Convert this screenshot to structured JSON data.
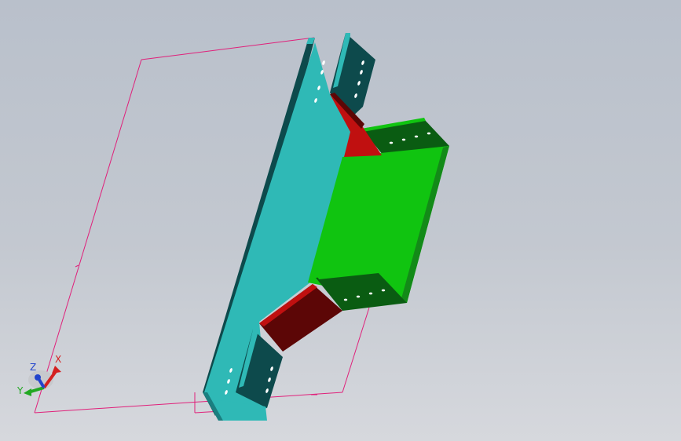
{
  "viewport": {
    "background_top": "#b9c0cb",
    "background_bottom": "#d6d8dd"
  },
  "model": {
    "colors": {
      "main_tray": "#2fb9b6",
      "main_tray_dark": "#0d4a4c",
      "main_tray_mid": "#1a7f80",
      "branch_tray": "#10c410",
      "branch_tray_dark": "#0a5c12",
      "branch_tray_mid": "#138a18",
      "connector_plate": "#c01010",
      "connector_plate_dark": "#5c0606",
      "sketch_line": "#e0207a"
    }
  },
  "triad": {
    "x_label": "X",
    "y_label": "Y",
    "z_label": "Z",
    "x_color": "#d42020",
    "y_color": "#22a822",
    "z_color": "#2244cc"
  }
}
